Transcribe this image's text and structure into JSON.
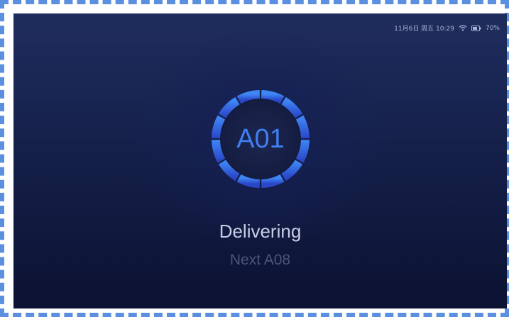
{
  "status_bar": {
    "datetime": "11月6日 周五 10:29",
    "wifi_icon": "wifi-icon",
    "battery_icon": "battery-icon",
    "battery": "70%"
  },
  "queue": {
    "current_number": "A01",
    "status": "Delivering",
    "next": "Next A08"
  },
  "colors": {
    "ring_top": "#3f86f5",
    "ring_bottom": "#2a47c9",
    "ticket_text": "#3f7ff0",
    "background_top": "#1f2d5e",
    "background_bottom": "#0b1232"
  }
}
